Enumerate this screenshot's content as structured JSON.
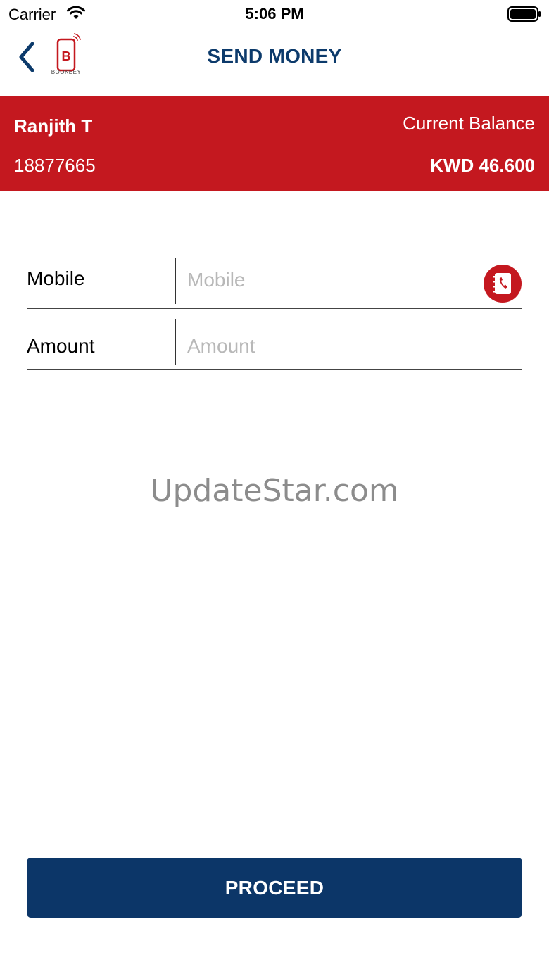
{
  "status_bar": {
    "carrier": "Carrier",
    "time": "5:06 PM"
  },
  "header": {
    "title": "SEND MONEY",
    "logo_text": "BOOKEEY",
    "logo_letter": "B"
  },
  "account": {
    "name": "Ranjith T",
    "number": "18877665",
    "balance_label": "Current Balance",
    "balance_value": "KWD 46.600"
  },
  "form": {
    "mobile_label": "Mobile",
    "mobile_placeholder": "Mobile",
    "mobile_value": "",
    "amount_label": "Amount",
    "amount_placeholder": "Amount",
    "amount_value": ""
  },
  "watermark": "UpdateStar.com",
  "actions": {
    "proceed_label": "PROCEED"
  },
  "colors": {
    "brand_red": "#c4181f",
    "brand_navy": "#0c3a6b",
    "button_navy": "#0c3668"
  },
  "icons": {
    "back": "chevron-left-icon",
    "contacts": "contact-book-icon",
    "wifi": "wifi-icon",
    "battery": "battery-icon"
  }
}
